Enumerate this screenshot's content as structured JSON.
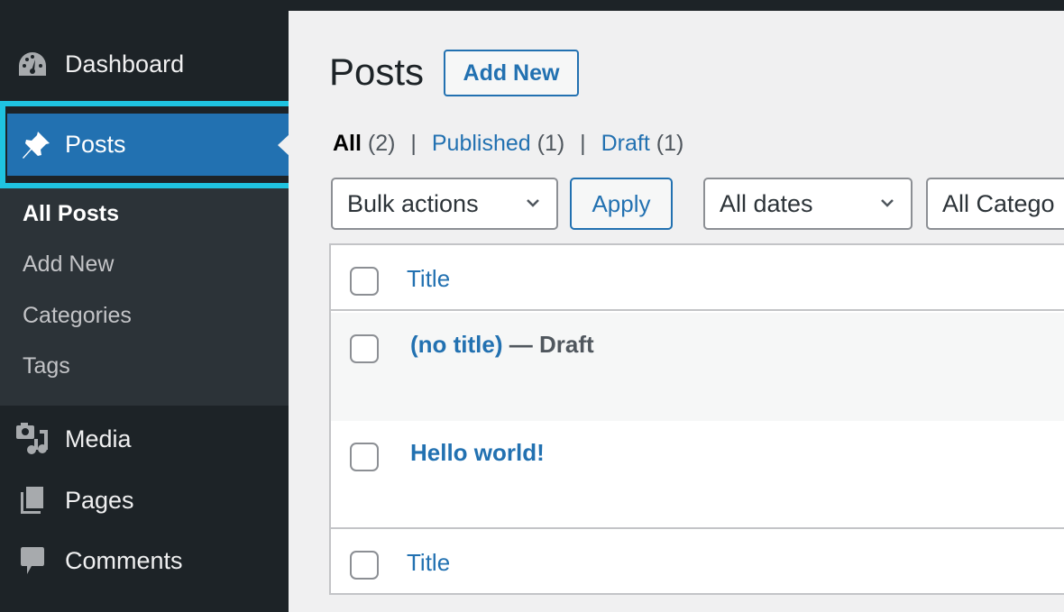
{
  "sidebar": {
    "items": [
      {
        "label": "Dashboard",
        "icon": "dashboard-icon"
      },
      {
        "label": "Posts",
        "icon": "pin-icon",
        "active": true
      },
      {
        "label": "Media",
        "icon": "media-icon"
      },
      {
        "label": "Pages",
        "icon": "pages-icon"
      },
      {
        "label": "Comments",
        "icon": "comments-icon"
      }
    ],
    "submenu": [
      {
        "label": "All Posts",
        "current": true
      },
      {
        "label": "Add New"
      },
      {
        "label": "Categories"
      },
      {
        "label": "Tags"
      }
    ]
  },
  "main": {
    "title": "Posts",
    "add_new_label": "Add New",
    "filters": [
      {
        "label": "All",
        "count": "(2)",
        "current": true
      },
      {
        "label": "Published",
        "count": "(1)"
      },
      {
        "label": "Draft",
        "count": "(1)"
      }
    ],
    "separator": "|",
    "bulk_actions": "Bulk actions",
    "apply_label": "Apply",
    "dates_filter": "All dates",
    "categories_filter": "All Catego",
    "table": {
      "header_title": "Title",
      "footer_title": "Title",
      "rows": [
        {
          "title": "(no title)",
          "state": " — Draft"
        },
        {
          "title": "Hello world!",
          "state": ""
        }
      ]
    }
  },
  "colors": {
    "accent": "#2271b1",
    "sidebar_bg": "#1d2327",
    "submenu_bg": "#2c3338",
    "highlight_outline": "#1fc3e0",
    "page_bg": "#f0f0f1"
  }
}
